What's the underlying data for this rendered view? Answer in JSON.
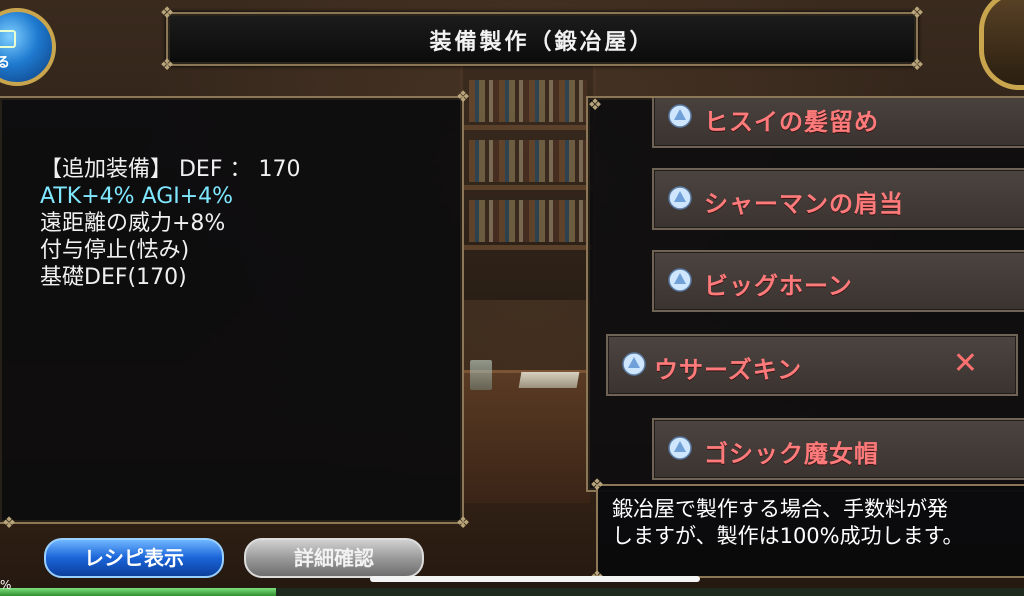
{
  "title": "装備製作（鍛冶屋）",
  "top_left_button": {
    "label": "る"
  },
  "details": {
    "header": "【追加装備】 DEF ： 170",
    "stat_line": "ATK+4% AGI+4%",
    "lines": [
      "遠距離の威力+8%",
      "付与停止(怯み)",
      "基礎DEF(170)"
    ]
  },
  "recipe_list": [
    {
      "name": "ヒスイの髪留め",
      "remove": "✕"
    },
    {
      "name": "シャーマンの肩当",
      "remove": "✕"
    },
    {
      "name": "ビッグホーン",
      "remove": "✕"
    },
    {
      "name": "ウサーズキン",
      "remove": "✕"
    },
    {
      "name": "ゴシック魔女帽",
      "remove": "✕"
    }
  ],
  "message": {
    "line1": "鍛冶屋で製作する場合、手数料が発",
    "line2": "しますが、製作は100%成功します。"
  },
  "buttons": {
    "recipe": "レシピ表示",
    "detail": "詳細確認"
  },
  "progress": {
    "fraction": 0.27,
    "label": "%"
  },
  "colors": {
    "accent_text": "#7fe8ff",
    "item_text": "#ff7b7b",
    "frame": "#8b7755",
    "progress": "#4fbf4f"
  }
}
